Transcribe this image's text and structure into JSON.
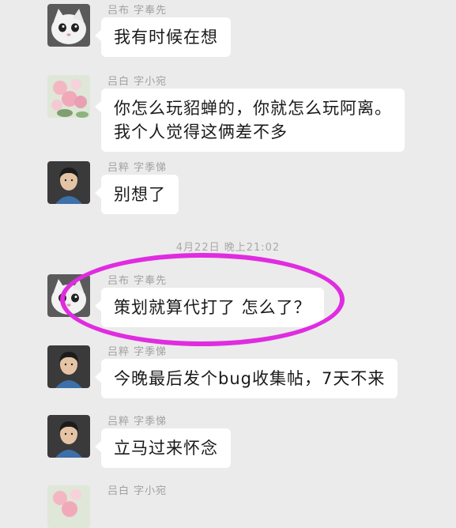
{
  "messages": [
    {
      "sender": "吕布  字奉先",
      "lines": [
        "我有时候在想"
      ],
      "avatar": "cat-avatar"
    },
    {
      "sender": "吕白  字小宛",
      "lines": [
        "你怎么玩貂蝉的，你就怎么玩阿离。",
        "我个人觉得这俩差不多"
      ],
      "avatar": "flower-avatar"
    },
    {
      "sender": "吕粹  字季悌",
      "lines": [
        "别想了"
      ],
      "avatar": "person-avatar"
    },
    {
      "sender": "吕布  字奉先",
      "lines": [
        "策划就算代打了 怎么了？"
      ],
      "avatar": "cat-avatar"
    },
    {
      "sender": "吕粹  字季悌",
      "lines": [
        "今晚最后发个bug收集帖，7天不来"
      ],
      "avatar": "person-avatar"
    },
    {
      "sender": "吕粹  字季悌",
      "lines": [
        "立马过来怀念"
      ],
      "avatar": "person-avatar"
    },
    {
      "sender": "吕白  字小宛",
      "lines": [
        ""
      ],
      "avatar": "flower-avatar"
    }
  ],
  "timestamp": "4月22日 晚上21:02",
  "highlight_color": "#e02ce0"
}
